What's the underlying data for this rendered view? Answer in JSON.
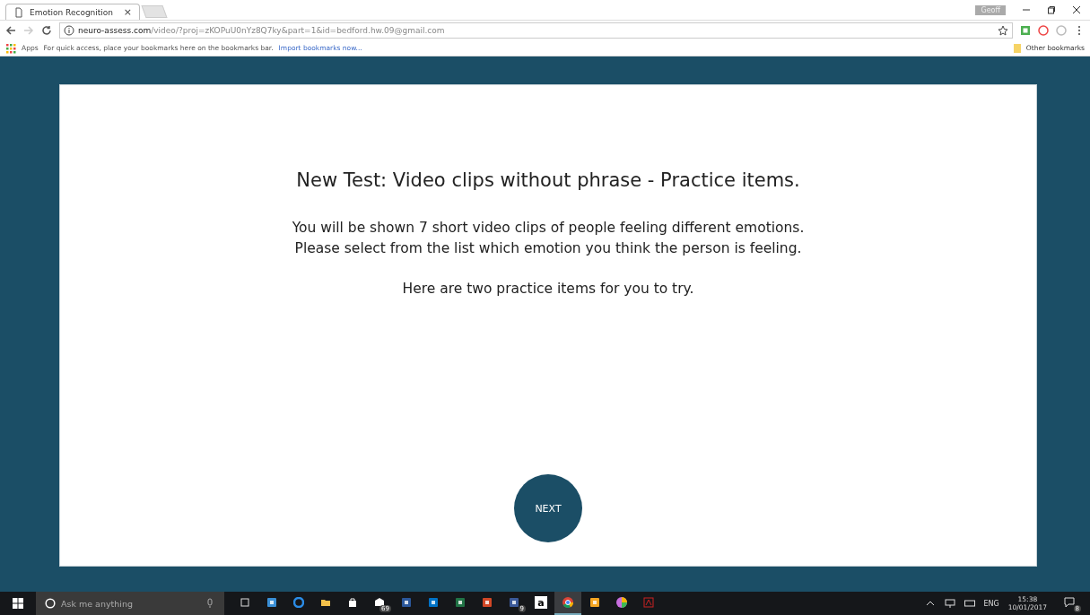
{
  "browser": {
    "tab": {
      "title": "Emotion Recognition",
      "close": "×"
    },
    "profile": "Geoff",
    "url": {
      "host": "neuro-assess.com",
      "path": "/video/?proj=zKOPuU0nYz8Q7ky&part=1&id=bedford.hw.09@gmail.com"
    },
    "bookmarks": {
      "apps": "Apps",
      "hint": "For quick access, place your bookmarks here on the bookmarks bar.",
      "import_link": "Import bookmarks now...",
      "other": "Other bookmarks"
    }
  },
  "page": {
    "title": "New Test: Video clips without phrase - Practice items.",
    "paragraphs": [
      "You will be shown 7 short video clips of people feeling different emotions.\nPlease select from the list which emotion you think the person is feeling.",
      "Here are two practice items for you to try."
    ],
    "button": "NEXT"
  },
  "taskbar": {
    "search_placeholder": "Ask me anything",
    "apps": [
      {
        "kind": "taskview",
        "selected": false
      },
      {
        "kind": "photos",
        "selected": false
      },
      {
        "kind": "edge",
        "selected": false
      },
      {
        "kind": "folder",
        "selected": false
      },
      {
        "kind": "store",
        "selected": false
      },
      {
        "kind": "mail",
        "badge": "69",
        "selected": false
      },
      {
        "kind": "word",
        "selected": false
      },
      {
        "kind": "outlook",
        "selected": false
      },
      {
        "kind": "excel",
        "selected": false
      },
      {
        "kind": "powerpoint",
        "selected": false
      },
      {
        "kind": "facebook",
        "badge": "9",
        "selected": false
      },
      {
        "kind": "amazon",
        "label": "a",
        "selected": false
      },
      {
        "kind": "chrome",
        "selected": true
      },
      {
        "kind": "plane",
        "selected": false
      },
      {
        "kind": "picasa",
        "selected": false
      },
      {
        "kind": "acrobat",
        "selected": false
      }
    ],
    "tray": {
      "language": "ENG",
      "time": "15:38",
      "date": "10/01/2017",
      "notifications": "8"
    }
  }
}
